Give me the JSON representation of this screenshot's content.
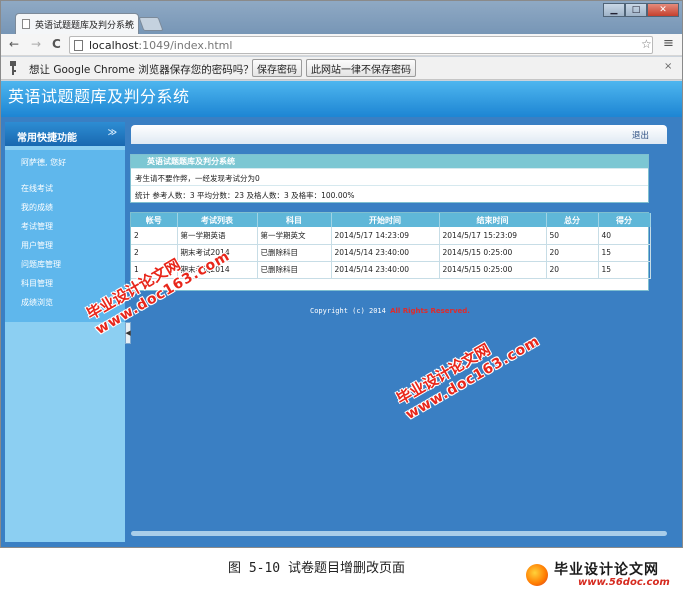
{
  "browser": {
    "tab_title": "英语试题题库及判分系统",
    "tab_close": "×",
    "url_host": "localhost",
    "url_path": ":1049/index.html",
    "window_controls": {
      "minimize": "▁",
      "maximize": "□",
      "close": "✕"
    },
    "nav": {
      "back": "←",
      "forward": "→",
      "reload": "C"
    },
    "star": "☆",
    "menu": "≡"
  },
  "infobar": {
    "message": "想让 Google Chrome 浏览器保存您的密码吗？",
    "save_button": "保存密码",
    "never_button": "此网站一律不保存密码",
    "close": "×"
  },
  "app": {
    "title": "英语试题题库及判分系统",
    "logout": "退出",
    "sidebar": {
      "heading": "常用快捷功能",
      "chevron": "≫",
      "items": [
        {
          "label": "阿萨德, 您好"
        },
        {
          "label": "在线考试"
        },
        {
          "label": "我的成绩"
        },
        {
          "label": "考试管理"
        },
        {
          "label": "用户管理"
        },
        {
          "label": "问题库管理"
        },
        {
          "label": "科目管理"
        },
        {
          "label": "成绩浏览"
        }
      ]
    },
    "collapse_handle": "◀"
  },
  "summary_panel": {
    "title": "英语试题题库及判分系统",
    "notice": "考生请不要作弊，一经发现考试分为0",
    "stats": "统计  参考人数：3  平均分数：23  及格人数：3  及格率：100.00%"
  },
  "results_table": {
    "headers": [
      "帐号",
      "考试列表",
      "科目",
      "开始时间",
      "结束时间",
      "总分",
      "得分"
    ],
    "rows": [
      [
        "2",
        "第一学期英语",
        "第一学期英文",
        "2014/5/17 14:23:09",
        "2014/5/17 15:23:09",
        "50",
        "40"
      ],
      [
        "2",
        "期末考试2014",
        "已删除科目",
        "2014/5/14 23:40:00",
        "2014/5/15 0:25:00",
        "20",
        "15"
      ],
      [
        "1",
        "期末考试2014",
        "已删除科目",
        "2014/5/14 23:40:00",
        "2014/5/15 0:25:00",
        "20",
        "15"
      ]
    ]
  },
  "footer": {
    "copyright": "Copyright (c) 2014 ",
    "rights": "All Rights Reserved."
  },
  "watermarks": {
    "cn": "毕业设计论文网",
    "url": "www.doc163.com"
  },
  "caption": "图 5-10 试卷题目增删改页面",
  "site_logo": {
    "name": "毕业设计论文网",
    "url": "www.56doc.com"
  }
}
